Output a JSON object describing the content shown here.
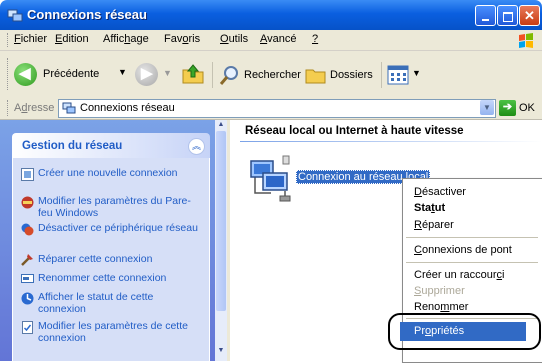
{
  "window": {
    "title": "Connexions réseau"
  },
  "menubar": {
    "items": [
      {
        "pre": "",
        "u": "F",
        "post": "ichier"
      },
      {
        "pre": "",
        "u": "E",
        "post": "dition"
      },
      {
        "pre": "Affic",
        "u": "h",
        "post": "age"
      },
      {
        "pre": "Fav",
        "u": "o",
        "post": "ris"
      },
      {
        "pre": "",
        "u": "O",
        "post": "utils"
      },
      {
        "pre": "",
        "u": "A",
        "post": "vancé"
      },
      {
        "pre": "",
        "u": "?",
        "post": ""
      }
    ]
  },
  "toolbar": {
    "back_label": "Précédente",
    "search_label": "Rechercher",
    "folders_label": "Dossiers"
  },
  "address": {
    "label_pre": "A",
    "label_u": "d",
    "label_post": "resse",
    "value": "Connexions réseau",
    "go_label": "OK"
  },
  "leftpanel": {
    "header": "Gestion du réseau",
    "tasks": [
      "Créer une nouvelle connexion",
      "Modifier les paramètres du Pare-feu Windows",
      "Désactiver ce périphérique réseau",
      "Réparer cette connexion",
      "Renommer cette connexion",
      "Afficher le statut de cette connexion",
      "Modifier les paramètres de cette connexion"
    ]
  },
  "main": {
    "section_title": "Réseau local ou Internet à haute vitesse",
    "connection_name": "Connexion au réseau local"
  },
  "context_menu": {
    "items": [
      {
        "pre": "",
        "u": "D",
        "post": "ésactiver"
      },
      {
        "pre": "Sta",
        "u": "t",
        "post": "ut"
      },
      {
        "pre": "",
        "u": "R",
        "post": "éparer"
      },
      {
        "pre": "",
        "u": "C",
        "post": "onnexions de pont"
      },
      {
        "pre": "Créer un raccour",
        "u": "c",
        "post": "i"
      },
      {
        "pre": "",
        "u": "S",
        "post": "upprimer"
      },
      {
        "pre": "Reno",
        "u": "m",
        "post": "mer"
      },
      {
        "pre": "Pr",
        "u": "o",
        "post": "priétés"
      }
    ]
  },
  "colors": {
    "titlebar": "#0a5fe0",
    "task_link": "#215dc6",
    "selection": "#316ac5",
    "menu_bg": "#ece9d8"
  }
}
